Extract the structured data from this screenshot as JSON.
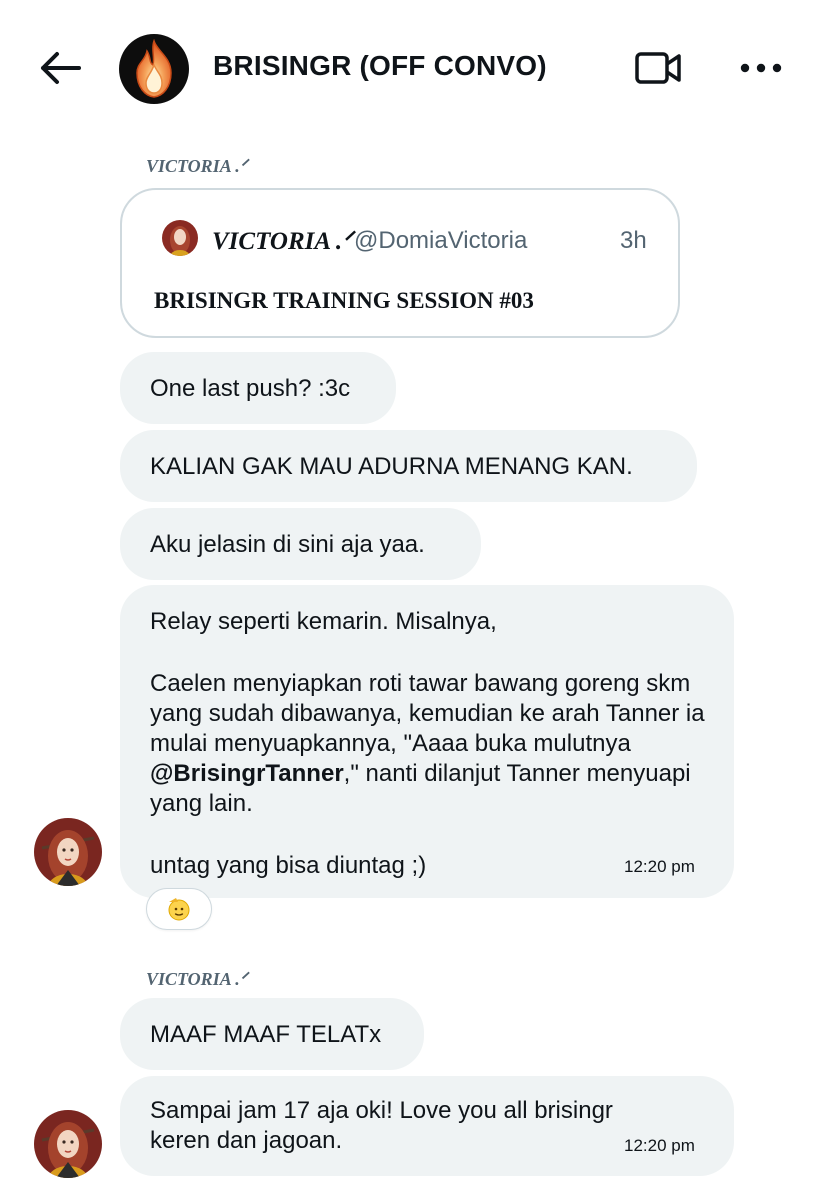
{
  "header": {
    "back_icon": "arrow-left-icon",
    "title": "BRISINGR (OFF CONVO)",
    "avatar_icon": "flame-icon",
    "video_icon": "video-camera-icon",
    "more_icon": "more-dots-icon"
  },
  "sender_label_1": "VICTORIA .ᐟ",
  "quoted_post": {
    "author_name": "VICTORIA .ᐟ",
    "author_handle": "@DomiaVictoria",
    "time": "3h",
    "text": "BRISINGR TRAINING SESSION #03"
  },
  "messages": [
    {
      "text": "One last push? :3c"
    },
    {
      "text": "KALIAN GAK MAU ADURNA MENANG KAN."
    },
    {
      "text": "Aku jelasin di sini aja yaa."
    },
    {
      "line1": "Relay seperti kemarin. Misalnya,",
      "para_before": "Caelen menyiapkan roti tawar bawang goreng skm yang sudah dibawanya, kemudian ke arah Tanner ia mulai menyuapkannya, \"Aaaa buka mulutnya ",
      "mention": "@BrisingrTanner",
      "para_after": ",\" nanti dilanjut Tanner menyuapi yang lain.",
      "last_line": "untag yang bisa diuntag ;)",
      "time": "12:20 pm",
      "reaction": "🫡"
    }
  ],
  "sender_label_2": "VICTORIA .ᐟ",
  "messages_2": [
    {
      "text": "MAAF MAAF TELATx"
    },
    {
      "text": "Sampai jam 17 aja oki! Love you all brisingr keren dan jagoan.",
      "time": "12:20 pm"
    }
  ],
  "colors": {
    "bubble_bg": "#eff3f4",
    "secondary_text": "#536471",
    "card_border": "#cfd9de"
  }
}
